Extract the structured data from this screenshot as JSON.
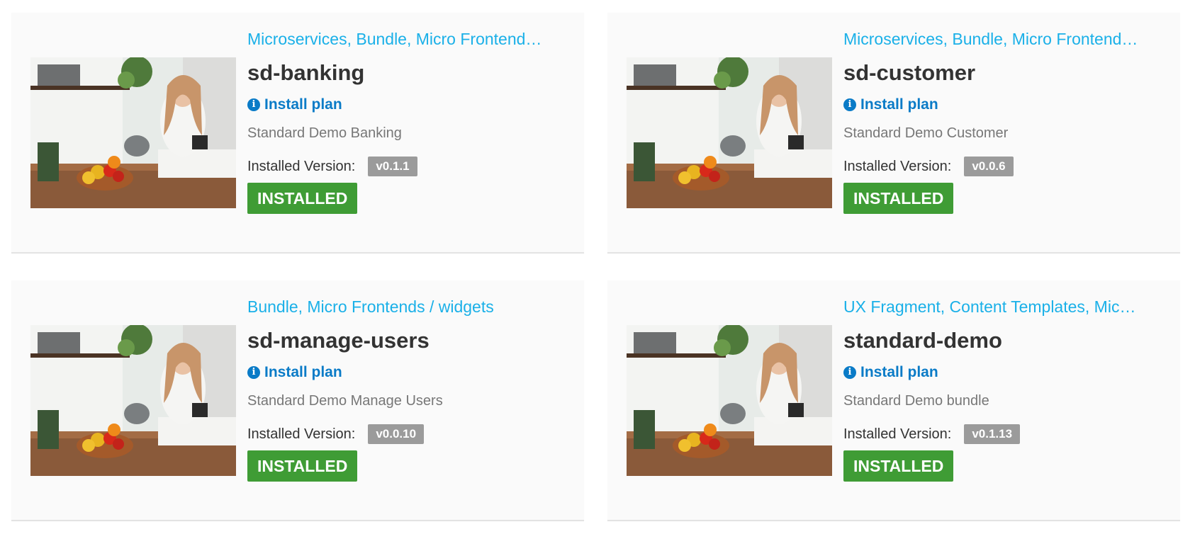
{
  "cards": [
    {
      "categories": "Microservices, Bundle, Micro Frontend…",
      "title": "sd-banking",
      "install_plan": "Install plan",
      "description": "Standard Demo Banking",
      "version_label": "Installed Version:",
      "version": "v0.1.1",
      "status": "INSTALLED"
    },
    {
      "categories": "Microservices, Bundle, Micro Frontend…",
      "title": "sd-customer",
      "install_plan": "Install plan",
      "description": "Standard Demo Customer",
      "version_label": "Installed Version:",
      "version": "v0.0.6",
      "status": "INSTALLED"
    },
    {
      "categories": "Bundle, Micro Frontends / widgets",
      "title": "sd-manage-users",
      "install_plan": "Install plan",
      "description": "Standard Demo Manage Users",
      "version_label": "Installed Version:",
      "version": "v0.0.10",
      "status": "INSTALLED"
    },
    {
      "categories": "UX Fragment, Content Templates, Mic…",
      "title": "standard-demo",
      "install_plan": "Install plan",
      "description": "Standard Demo bundle",
      "version_label": "Installed Version:",
      "version": "v0.1.13",
      "status": "INSTALLED"
    }
  ],
  "icons": {
    "install_plan": "info-circle-icon",
    "thumbnail": "kitchen-photo"
  },
  "colors": {
    "category_link": "#1ab0e8",
    "install_plan_link": "#0a7bc7",
    "installed_button": "#3f9c35",
    "version_badge": "#9b9b9b"
  }
}
